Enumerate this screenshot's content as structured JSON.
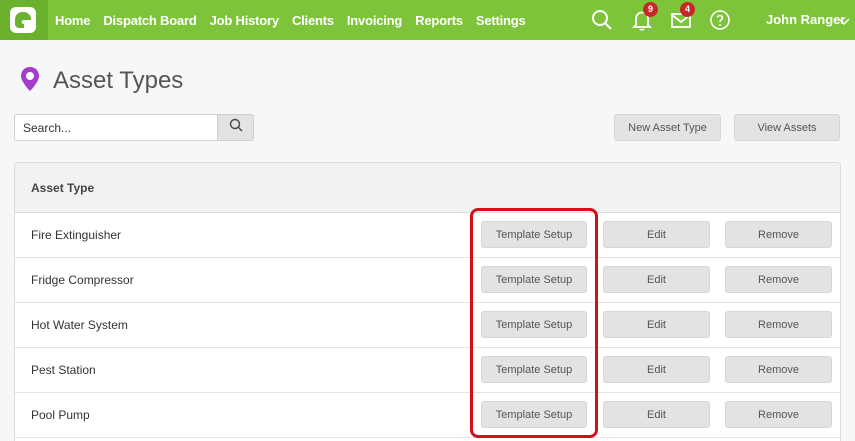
{
  "nav": {
    "items": [
      "Home",
      "Dispatch Board",
      "Job History",
      "Clients",
      "Invoicing",
      "Reports",
      "Settings"
    ],
    "notifications_count": "9",
    "messages_count": "4",
    "user_name": "John Ranger"
  },
  "page": {
    "title": "Asset Types"
  },
  "search": {
    "placeholder": "Search..."
  },
  "toolbar": {
    "new_label": "New Asset Type",
    "view_label": "View Assets"
  },
  "table": {
    "header": "Asset Type",
    "template_label": "Template Setup",
    "edit_label": "Edit",
    "remove_label": "Remove",
    "rows": [
      "Fire Extinguisher",
      "Fridge Compressor",
      "Hot Water System",
      "Pest Station",
      "Pool Pump"
    ]
  },
  "colors": {
    "nav_green": "#7dc43a",
    "logo_green": "#6ab22d",
    "badge_red": "#c62828",
    "highlight_red": "#d0121b",
    "title_icon_purple": "#a23ec9"
  },
  "icons": {
    "logo": "app-logo-icon",
    "search": "search-icon",
    "notifications": "bell-icon",
    "messages": "envelope-icon",
    "help": "help-icon",
    "user_menu": "chevron-down-icon",
    "title": "location-pin-icon"
  }
}
